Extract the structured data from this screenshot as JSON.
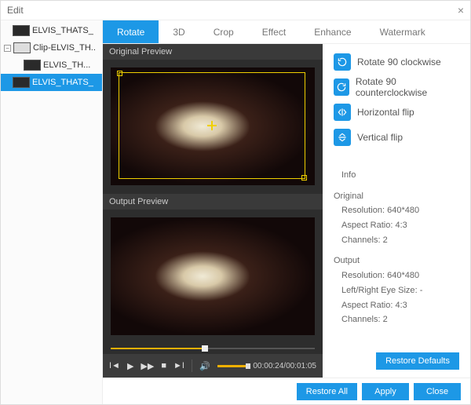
{
  "window": {
    "title": "Edit"
  },
  "tree": {
    "items": [
      {
        "label": "ELVIS_THATS_",
        "indent": 0,
        "thumb": "dark",
        "selected": false
      },
      {
        "label": "Clip-ELVIS_TH..",
        "indent": 0,
        "thumb": "light",
        "expander": "-",
        "selected": false
      },
      {
        "label": "ELVIS_TH...",
        "indent": 1,
        "thumb": "dark",
        "selected": false
      },
      {
        "label": "ELVIS_THATS_",
        "indent": 0,
        "thumb": "dark",
        "selected": true
      }
    ]
  },
  "tabs": [
    {
      "label": "Rotate",
      "active": true
    },
    {
      "label": "3D"
    },
    {
      "label": "Crop"
    },
    {
      "label": "Effect"
    },
    {
      "label": "Enhance"
    },
    {
      "label": "Watermark"
    }
  ],
  "preview": {
    "original_label": "Original Preview",
    "output_label": "Output Preview"
  },
  "player": {
    "time": "00:00:24/00:01:05"
  },
  "ops": {
    "rotate_cw": "Rotate 90 clockwise",
    "rotate_ccw": "Rotate 90 counterclockwise",
    "hflip": "Horizontal flip",
    "vflip": "Vertical flip"
  },
  "info": {
    "title": "Info",
    "original": {
      "heading": "Original",
      "resolution_k": "Resolution",
      "resolution_v": "640*480",
      "aspect_k": "Aspect Ratio",
      "aspect_v": "4:3",
      "channels_k": "Channels",
      "channels_v": "2"
    },
    "output": {
      "heading": "Output",
      "resolution_k": "Resolution",
      "resolution_v": "640*480",
      "eye_k": "Left/Right Eye Size",
      "eye_v": "-",
      "aspect_k": "Aspect Ratio",
      "aspect_v": "4:3",
      "channels_k": "Channels",
      "channels_v": "2"
    }
  },
  "buttons": {
    "restore_defaults": "Restore Defaults",
    "restore_all": "Restore All",
    "apply": "Apply",
    "close": "Close"
  }
}
